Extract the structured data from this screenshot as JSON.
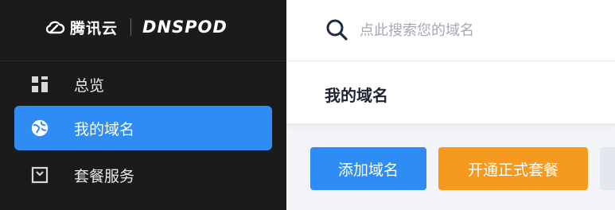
{
  "brand": {
    "name_cn": "腾讯云",
    "name_en": "DNSPOD"
  },
  "sidebar": {
    "items": [
      {
        "label": "总览",
        "icon": "dashboard-grid-icon",
        "active": false
      },
      {
        "label": "我的域名",
        "icon": "globe-icon",
        "active": true
      },
      {
        "label": "套餐服务",
        "icon": "package-icon",
        "active": false
      }
    ]
  },
  "search": {
    "placeholder": "点此搜索您的域名",
    "value": ""
  },
  "page": {
    "title": "我的域名"
  },
  "toolbar": {
    "add_domain_label": "添加域名",
    "open_pro_label": "开通正式套餐"
  },
  "colors": {
    "sidebar_bg": "#1b1b1b",
    "accent_blue": "#2f8cf5",
    "accent_orange": "#f69a1f"
  }
}
